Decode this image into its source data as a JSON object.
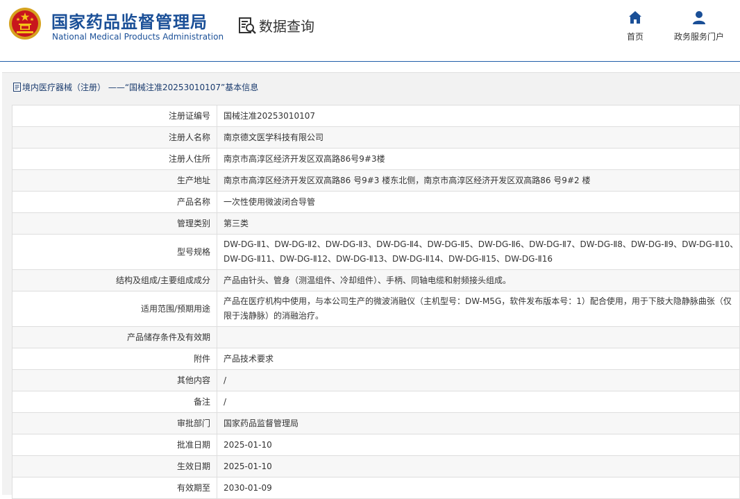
{
  "header": {
    "site_name_cn": "国家药品监督管理局",
    "site_name_en": "National Medical Products Administration",
    "query_label": "数据查询",
    "nav": {
      "home": "首页",
      "service": "政务服务门户"
    }
  },
  "panel": {
    "title": "境内医疗器械（注册） ——“国械注准20253010107”基本信息"
  },
  "rows": [
    {
      "label": "注册证编号",
      "value": "国械注准20253010107"
    },
    {
      "label": "注册人名称",
      "value": "南京德文医学科技有限公司"
    },
    {
      "label": "注册人住所",
      "value": "南京市高淳区经济开发区双高路86号9#3楼"
    },
    {
      "label": "生产地址",
      "value": "南京市高淳区经济开发区双高路86 号9#3 楼东北侧，南京市高淳区经济开发区双高路86 号9#2 楼"
    },
    {
      "label": "产品名称",
      "value": "一次性使用微波闭合导管"
    },
    {
      "label": "管理类别",
      "value": "第三类"
    },
    {
      "label": "型号规格",
      "value": "DW-DG-Ⅱ1、DW-DG-Ⅱ2、DW-DG-Ⅱ3、DW-DG-Ⅱ4、DW-DG-Ⅱ5、DW-DG-Ⅱ6、DW-DG-Ⅱ7、DW-DG-Ⅱ8、DW-DG-Ⅱ9、DW-DG-Ⅱ10、DW-DG-Ⅱ11、DW-DG-Ⅱ12、DW-DG-Ⅱ13、DW-DG-Ⅱ14、DW-DG-Ⅱ15、DW-DG-Ⅱ16"
    },
    {
      "label": "结构及组成/主要组成成分",
      "value": "产品由针头、管身（测温组件、冷却组件）、手柄、同轴电缆和射频接头组成。"
    },
    {
      "label": "适用范围/预期用途",
      "value": "产品在医疗机构中使用，与本公司生产的微波消融仪（主机型号：DW-M5G，软件发布版本号：1）配合使用，用于下肢大隐静脉曲张（仅限于浅静脉）的消融治疗。"
    },
    {
      "label": "产品储存条件及有效期",
      "value": ""
    },
    {
      "label": "附件",
      "value": "产品技术要求"
    },
    {
      "label": "其他内容",
      "value": "/"
    },
    {
      "label": "备注",
      "value": "/"
    },
    {
      "label": "审批部门",
      "value": "国家药品监督管理局"
    },
    {
      "label": "批准日期",
      "value": "2025-01-10"
    },
    {
      "label": "生效日期",
      "value": "2025-01-10"
    },
    {
      "label": "有效期至",
      "value": "2030-01-09"
    }
  ],
  "icons": {
    "logo": "national-emblem-icon",
    "query": "document-search-icon",
    "home": "home-icon",
    "service": "user-icon",
    "title": "document-icon"
  },
  "colors": {
    "brand": "#1a4f97",
    "header_line": "#1f5ea8",
    "panel_bg": "#f2f2f2",
    "row_alt": "#f7f7f7",
    "border": "#dedede"
  }
}
